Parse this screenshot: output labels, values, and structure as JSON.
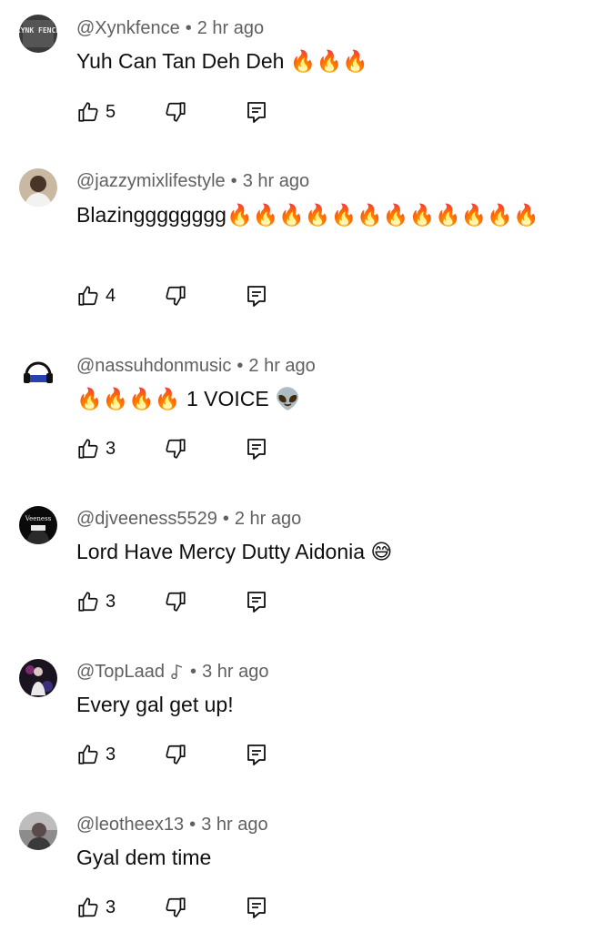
{
  "icons": {
    "like": "thumbs-up-icon",
    "dislike": "thumbs-down-icon",
    "reply": "reply-comment-icon",
    "creator_note": "music-note-icon"
  },
  "colors": {
    "text": "#0f0f0f",
    "meta": "#606060",
    "background": "#ffffff"
  },
  "separator": "•",
  "comments": [
    {
      "handle": "@Xynkfence",
      "time": "2 hr ago",
      "text": "Yuh Can Tan Deh Deh 🔥🔥🔥",
      "likes": "5",
      "avatar_text": "XYNK FENCE",
      "has_note": false
    },
    {
      "handle": "@jazzymixlifestyle",
      "time": "3 hr ago",
      "text": "Blazingggggggg🔥🔥🔥🔥🔥🔥🔥🔥🔥🔥🔥🔥",
      "likes": "4",
      "avatar_text": "",
      "has_note": false
    },
    {
      "handle": "@nassuhdonmusic",
      "time": "2 hr ago",
      "text": "🔥🔥🔥🔥 1 VOICE 👽",
      "likes": "3",
      "avatar_text": "",
      "has_note": false
    },
    {
      "handle": "@djveeness5529",
      "time": "2 hr ago",
      "text": "Lord Have Mercy Dutty Aidonia 😅",
      "likes": "3",
      "avatar_text": "Veeness",
      "has_note": false
    },
    {
      "handle": "@TopLaad",
      "time": "3 hr ago",
      "text": "Every gal get up!",
      "likes": "3",
      "avatar_text": "",
      "has_note": true
    },
    {
      "handle": "@leotheex13",
      "time": "3 hr ago",
      "text": "Gyal dem time",
      "likes": "3",
      "avatar_text": "",
      "has_note": false
    }
  ]
}
